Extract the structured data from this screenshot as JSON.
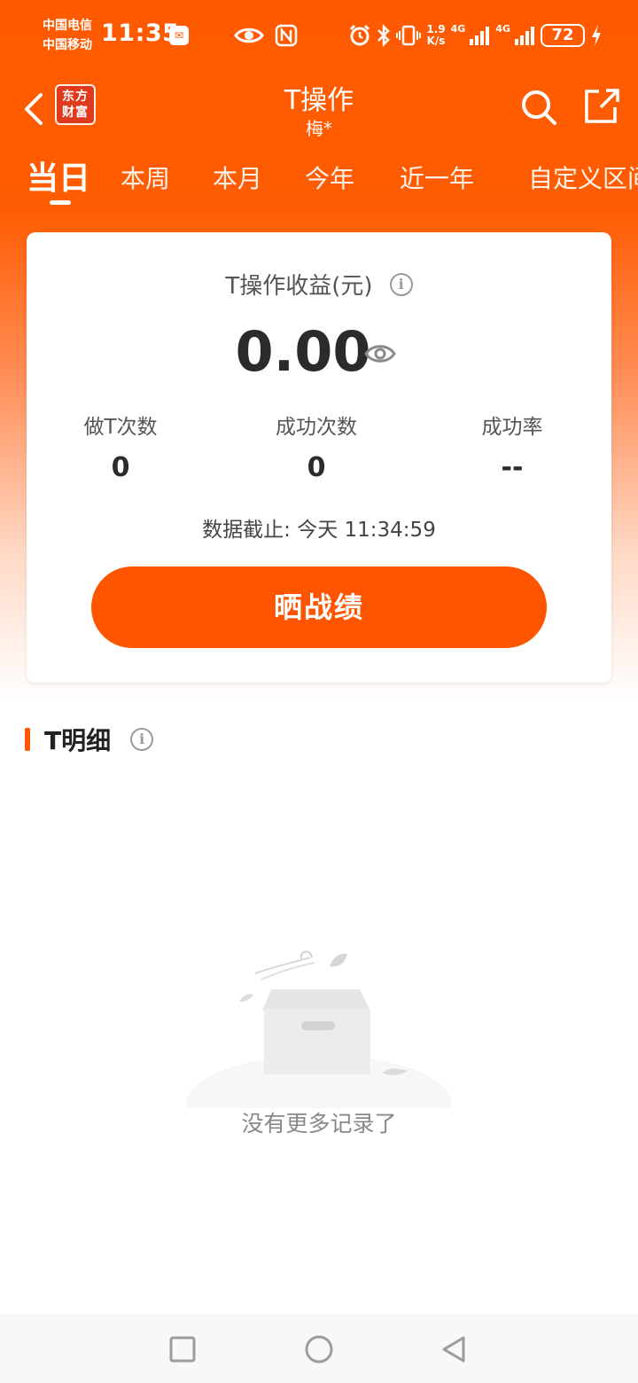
{
  "status_bar": {
    "carrier_1": "中国电信",
    "carrier_2": "中国移动",
    "time": "11:35",
    "net_speed_value": "1.9",
    "net_speed_unit": "K/s",
    "signal_1_label": "4G",
    "signal_2_label": "4G",
    "battery": "72",
    "icons": [
      "app-notification-icon",
      "eye-icon",
      "nfc-icon",
      "alarm-icon",
      "bluetooth-icon",
      "vibrate-icon",
      "signal-icon",
      "battery-icon",
      "charging-icon"
    ]
  },
  "header": {
    "logo_line1": "东方",
    "logo_line2": "财富",
    "title": "T操作",
    "subtitle": "梅*"
  },
  "tabs": [
    "当日",
    "本周",
    "本月",
    "今年",
    "近一年",
    "自定义区间"
  ],
  "active_tab": 0,
  "summary": {
    "profit_label": "T操作收益(元)",
    "profit_value": "0.00",
    "stats": [
      {
        "label": "做T次数",
        "value": "0"
      },
      {
        "label": "成功次数",
        "value": "0"
      },
      {
        "label": "成功率",
        "value": "--"
      }
    ],
    "cutoff_text": "数据截止: 今天 11:34:59",
    "share_button": "晒战绩"
  },
  "detail": {
    "title": "T明细",
    "empty_text": "没有更多记录了"
  },
  "colors": {
    "brand": "#ff5500",
    "header_bg": "#ff5a00"
  }
}
